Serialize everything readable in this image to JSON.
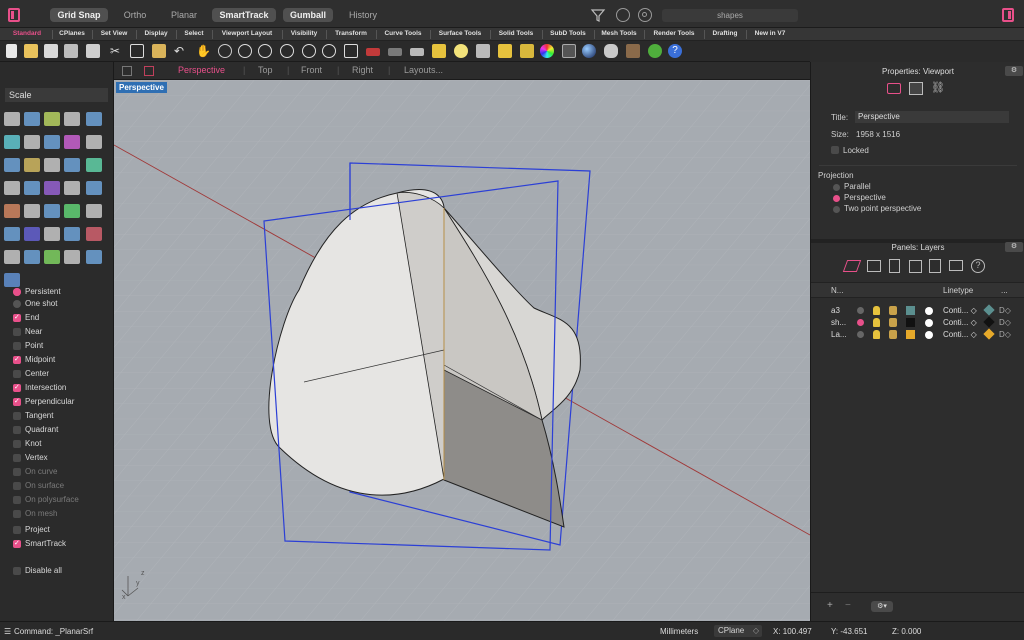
{
  "topbar": {
    "grid_snap": "Grid Snap",
    "ortho": "Ortho",
    "planar": "Planar",
    "smarttrack": "SmartTrack",
    "gumball": "Gumball",
    "history": "History",
    "search_value": "shapes"
  },
  "tabs": [
    "Standard",
    "CPlanes",
    "Set View",
    "Display",
    "Select",
    "Viewport Layout",
    "Visibility",
    "Transform",
    "Curve Tools",
    "Surface Tools",
    "Solid Tools",
    "SubD Tools",
    "Mesh Tools",
    "Render Tools",
    "Drafting",
    "New in V7"
  ],
  "viewport_tabs": [
    "Perspective",
    "Top",
    "Front",
    "Right",
    "Layouts..."
  ],
  "viewport_label": "Perspective",
  "left": {
    "command_box": "Scale",
    "osnaps": [
      {
        "label": "Persistent",
        "type": "radio",
        "on": true
      },
      {
        "label": "One shot",
        "type": "radio",
        "on": false
      },
      {
        "label": "End",
        "type": "check",
        "on": true
      },
      {
        "label": "Near",
        "type": "check",
        "on": false
      },
      {
        "label": "Point",
        "type": "check",
        "on": false
      },
      {
        "label": "Midpoint",
        "type": "check",
        "on": true
      },
      {
        "label": "Center",
        "type": "check",
        "on": false
      },
      {
        "label": "Intersection",
        "type": "check",
        "on": true
      },
      {
        "label": "Perpendicular",
        "type": "check",
        "on": true
      },
      {
        "label": "Tangent",
        "type": "check",
        "on": false
      },
      {
        "label": "Quadrant",
        "type": "check",
        "on": false
      },
      {
        "label": "Knot",
        "type": "check",
        "on": false
      },
      {
        "label": "Vertex",
        "type": "check",
        "on": false
      },
      {
        "label": "On curve",
        "type": "check",
        "on": false,
        "dim": true
      },
      {
        "label": "On surface",
        "type": "check",
        "on": false,
        "dim": true
      },
      {
        "label": "On polysurface",
        "type": "check",
        "on": false,
        "dim": true
      },
      {
        "label": "On mesh",
        "type": "check",
        "on": false,
        "dim": true
      },
      {
        "label": "Project",
        "type": "check",
        "on": false
      },
      {
        "label": "SmartTrack",
        "type": "check",
        "on": true
      },
      {
        "label": "Disable all",
        "type": "check",
        "on": false
      }
    ]
  },
  "properties": {
    "header": "Properties: Viewport",
    "title_label": "Title:",
    "title_value": "Perspective",
    "size_label": "Size:",
    "size_value": "1958 x 1516",
    "locked_label": "Locked",
    "projection_label": "Projection",
    "projection_options": [
      "Parallel",
      "Perspective",
      "Two point perspective"
    ],
    "projection_selected": 1
  },
  "layers": {
    "header": "Panels: Layers",
    "col_name": "N...",
    "col_linetype": "Linetype",
    "col_more": "...",
    "rows": [
      {
        "name": "a3",
        "linetype": "Conti... ◇",
        "color": "#5b8f8f",
        "current": false
      },
      {
        "name": "sh...",
        "linetype": "Conti... ◇",
        "color": "#111111",
        "current": true
      },
      {
        "name": "La...",
        "linetype": "Conti... ◇",
        "color": "#e6a92a",
        "current": false
      }
    ]
  },
  "status": {
    "command": "Command: _PlanarSrf",
    "units": "Millimeters",
    "cplane": "CPlane",
    "x": "X: 100.497",
    "y": "Y: -43.651",
    "z": "Z: 0.000"
  },
  "colors": {
    "accent": "#e8508a",
    "viewport_bg": "#a6abb1",
    "frame_blue": "#2b3fd6"
  }
}
